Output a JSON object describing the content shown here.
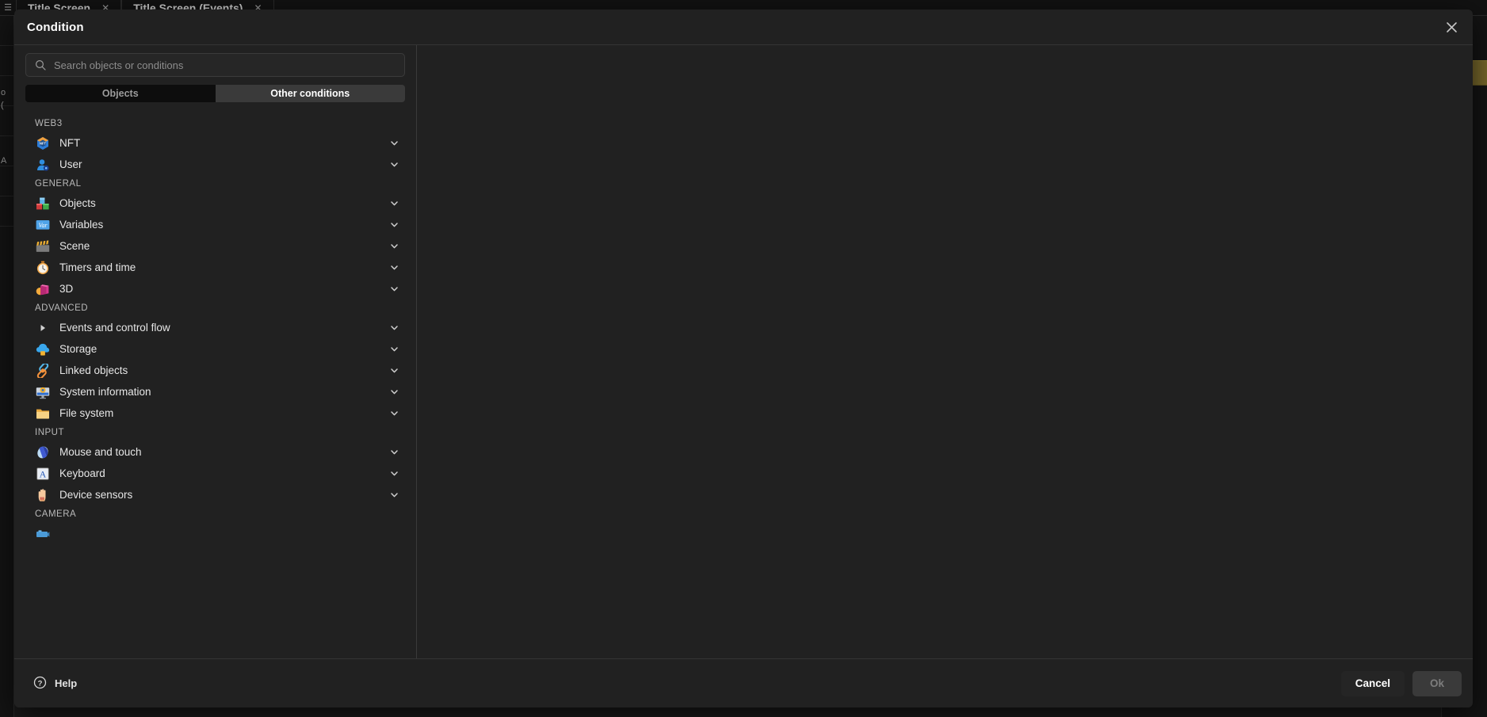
{
  "background": {
    "tabs": [
      {
        "label": "Title Screen",
        "close": "✕"
      },
      {
        "label": "Title Screen (Events)",
        "close": "✕"
      }
    ],
    "menu_icon": "☰",
    "search_icon": "search-icon",
    "add_text": "Ad",
    "rail_glyph_1": "o",
    "rail_glyph_2": "(",
    "rail_glyph_3": "A"
  },
  "dialog": {
    "title": "Condition",
    "close_label": "✕",
    "search": {
      "placeholder": "Search objects or conditions",
      "value": "",
      "icon": "search-icon"
    },
    "tabs": [
      {
        "id": "objects",
        "label": "Objects",
        "active": false
      },
      {
        "id": "other-conditions",
        "label": "Other conditions",
        "active": true
      }
    ],
    "groups": [
      {
        "label": "WEB3",
        "items": [
          {
            "label": "NFT",
            "icon": "nft-icon",
            "expandable": true
          },
          {
            "label": "User",
            "icon": "user-icon",
            "expandable": true
          }
        ]
      },
      {
        "label": "GENERAL",
        "items": [
          {
            "label": "Objects",
            "icon": "objects-blocks-icon",
            "expandable": true
          },
          {
            "label": "Variables",
            "icon": "variables-var-icon",
            "expandable": true
          },
          {
            "label": "Scene",
            "icon": "clapperboard-icon",
            "expandable": true
          },
          {
            "label": "Timers and time",
            "icon": "stopwatch-icon",
            "expandable": true
          },
          {
            "label": "3D",
            "icon": "cube-3d-icon",
            "expandable": true
          }
        ]
      },
      {
        "label": "ADVANCED",
        "items": [
          {
            "label": "Events and control flow",
            "icon": "caret-right-icon",
            "expandable": true
          },
          {
            "label": "Storage",
            "icon": "cloud-upload-icon",
            "expandable": true
          },
          {
            "label": "Linked objects",
            "icon": "link-chain-icon",
            "expandable": true
          },
          {
            "label": "System information",
            "icon": "monitor-gear-icon",
            "expandable": true
          },
          {
            "label": "File system",
            "icon": "folder-icon",
            "expandable": true
          }
        ]
      },
      {
        "label": "INPUT",
        "items": [
          {
            "label": "Mouse and touch",
            "icon": "mouse-icon",
            "expandable": true
          },
          {
            "label": "Keyboard",
            "icon": "keyboard-key-a-icon",
            "expandable": true
          },
          {
            "label": "Device sensors",
            "icon": "hand-sensor-icon",
            "expandable": true
          }
        ]
      },
      {
        "label": "CAMERA",
        "items": [
          {
            "label": "",
            "icon": "camera-icon",
            "expandable": false
          }
        ]
      }
    ],
    "chevron": "˅",
    "footer": {
      "help_label": "Help",
      "help_icon": "question-circle-icon",
      "cancel_label": "Cancel",
      "ok_label": "Ok"
    }
  },
  "colors": {
    "dialog_bg": "#212121",
    "panel_bg": "#1a1a1a",
    "tab_active_bg": "#3a3a3a",
    "tab_inactive_bg": "#0d0d0d",
    "accent_olive": "#7a6a2c",
    "text_primary": "#e6e6e6",
    "text_muted": "#8d8d8d"
  }
}
